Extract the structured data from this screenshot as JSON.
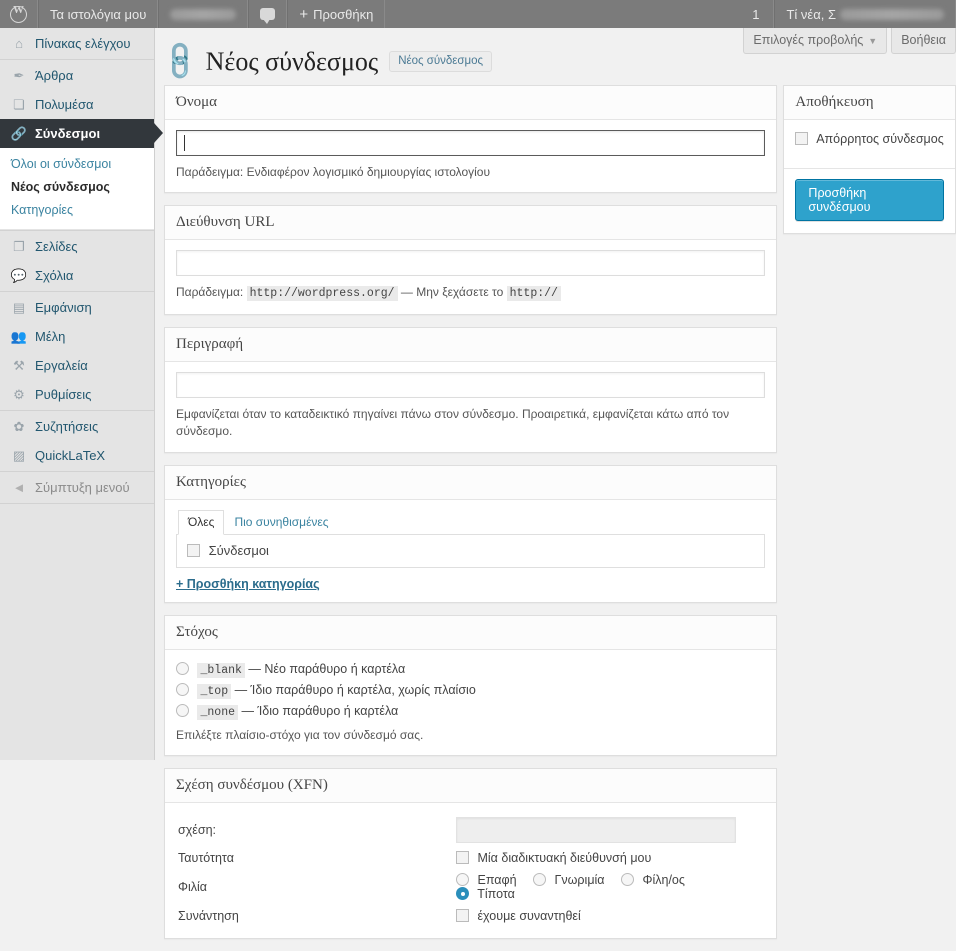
{
  "adminbar": {
    "logo_icon": "wordpress-logo-icon",
    "my_sites": "Τα ιστολόγια μου",
    "site_name_blurred": "",
    "comments_icon": "comment-bubble-icon",
    "new_label": "Προσθήκη",
    "count": "1",
    "howdy": "Τί νέα, Σ"
  },
  "screen_meta": {
    "screen_options": "Επιλογές προβολής",
    "help": "Βοήθεια"
  },
  "sidebar": {
    "groups": [
      {
        "items": [
          {
            "label": "Πίνακας ελέγχου",
            "icon": "dashboard-icon",
            "current": false
          }
        ]
      },
      {
        "items": [
          {
            "label": "Άρθρα",
            "icon": "pin-icon",
            "current": false
          },
          {
            "label": "Πολυμέσα",
            "icon": "media-icon",
            "current": false
          },
          {
            "label": "Σύνδεσμοι",
            "icon": "link-icon",
            "current": true
          }
        ],
        "submenu": [
          {
            "label": "Όλοι οι σύνδεσμοι",
            "current": false
          },
          {
            "label": "Νέος σύνδεσμος",
            "current": true
          },
          {
            "label": "Κατηγορίες",
            "current": false
          }
        ]
      },
      {
        "items": [
          {
            "label": "Σελίδες",
            "icon": "page-icon",
            "current": false
          },
          {
            "label": "Σχόλια",
            "icon": "comments-icon",
            "current": false
          }
        ]
      },
      {
        "items": [
          {
            "label": "Εμφάνιση",
            "icon": "appearance-icon",
            "current": false
          },
          {
            "label": "Μέλη",
            "icon": "users-icon",
            "current": false
          },
          {
            "label": "Εργαλεία",
            "icon": "tools-icon",
            "current": false
          },
          {
            "label": "Ρυθμίσεις",
            "icon": "settings-icon",
            "current": false
          }
        ]
      },
      {
        "items": [
          {
            "label": "Συζητήσεις",
            "icon": "gear-icon",
            "current": false
          },
          {
            "label": "QuickLaTeX",
            "icon": "quicklatex-icon",
            "current": false
          }
        ]
      },
      {
        "items": [
          {
            "label": "Σύμπτυξη μενού",
            "icon": "collapse-arrow-icon",
            "current": false
          }
        ]
      }
    ]
  },
  "page": {
    "icon": "link-icon",
    "title": "Νέος σύνδεσμος",
    "title_action": "Νέος σύνδεσμος"
  },
  "boxes": {
    "name": {
      "title": "Όνομα",
      "value": "",
      "hint": "Παράδειγμα: Ενδιαφέρον λογισμικό δημιουργίας ιστολογίου"
    },
    "url": {
      "title": "Διεύθυνση URL",
      "value": "",
      "hint_prefix": "Παράδειγμα:",
      "hint_code1": "http://wordpress.org/",
      "hint_middle": "— Μην ξεχάσετε το",
      "hint_code2": "http://"
    },
    "description": {
      "title": "Περιγραφή",
      "value": "",
      "hint": "Εμφανίζεται όταν το καταδεικτικό πηγαίνει πάνω στον σύνδεσμο. Προαιρετικά, εμφανίζεται κάτω από τον σύνδεσμο."
    },
    "categories": {
      "title": "Κατηγορίες",
      "tabs": [
        {
          "label": "Όλες",
          "active": true
        },
        {
          "label": "Πιο συνηθισμένες",
          "active": false
        }
      ],
      "items": [
        {
          "label": "Σύνδεσμοι",
          "checked": false
        }
      ],
      "add_link": "+ Προσθήκη κατηγορίας"
    },
    "target": {
      "title": "Στόχος",
      "options": [
        {
          "code": "_blank",
          "desc": "— Νέο παράθυρο ή καρτέλα",
          "checked": false
        },
        {
          "code": "_top",
          "desc": "— Ίδιο παράθυρο ή καρτέλα, χωρίς πλαίσιο",
          "checked": false
        },
        {
          "code": "_none",
          "desc": "— Ίδιο παράθυρο ή καρτέλα",
          "checked": false
        }
      ],
      "hint": "Επιλέξτε πλαίσιο-στόχο για τον σύνδεσμό σας."
    },
    "xfn": {
      "title": "Σχέση συνδέσμου (XFN)",
      "rel_label": "σχέση:",
      "rel_value": "",
      "rows": [
        {
          "label": "Ταυτότητα",
          "type": "checkbox",
          "options": [
            {
              "label": "Μία διαδικτυακή διεύθυνσή μου",
              "checked": false
            }
          ]
        },
        {
          "label": "Φιλία",
          "type": "radio",
          "options": [
            {
              "label": "Επαφή",
              "checked": false
            },
            {
              "label": "Γνωριμία",
              "checked": false
            },
            {
              "label": "Φίλη/ος",
              "checked": false
            },
            {
              "label": "Τίποτα",
              "checked": true
            }
          ]
        },
        {
          "label": "Συνάντηση",
          "type": "checkbox",
          "options": [
            {
              "label": "έχουμε συναντηθεί",
              "checked": false
            }
          ]
        }
      ]
    }
  },
  "submitbox": {
    "title": "Αποθήκευση",
    "private_label": "Απόρρητος σύνδεσμος",
    "private_checked": false,
    "submit_label": "Προσθήκη συνδέσμου"
  },
  "colors": {
    "accent": "#2ea2cc",
    "adminbar": "#7b7b7b",
    "menu_current": "#32373c",
    "sidebar_bg": "#e4e4e4",
    "content_bg": "#f1f1f1"
  }
}
